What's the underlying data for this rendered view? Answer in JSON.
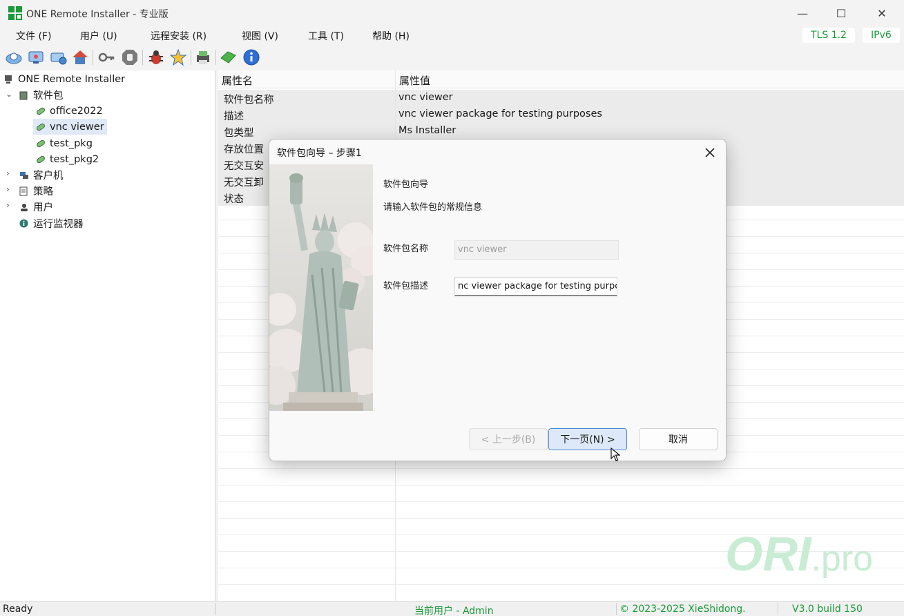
{
  "window": {
    "title": "ONE Remote Installer - 专业版",
    "minimize_glyph": "—",
    "maximize_glyph": "☐",
    "close_glyph": "✕"
  },
  "menu": {
    "items": [
      "文件 (F)",
      "用户 (U)",
      "远程安装 (R)",
      "视图 (V)",
      "工具 (T)",
      "帮助 (H)"
    ],
    "badges": [
      "TLS 1.2",
      "IPv6"
    ]
  },
  "toolbar": {
    "icons": [
      "connect-icon",
      "monitor-icon",
      "network-icon",
      "house-icon",
      "key-icon",
      "stop-hand-icon",
      "bug-icon",
      "star-icon",
      "printer-icon",
      "gem-icon",
      "info-icon"
    ]
  },
  "tree": {
    "root": "ONE Remote Installer",
    "packages": "软件包",
    "package_items": [
      "office2022",
      "vnc viewer",
      "test_pkg",
      "test_pkg2"
    ],
    "clients": "客户机",
    "policies": "策略",
    "users": "用户",
    "monitor": "运行监视器"
  },
  "properties": {
    "col_name": "属性名",
    "col_value": "属性值",
    "rows": [
      {
        "k": "软件包名称",
        "v": "vnc viewer"
      },
      {
        "k": "描述",
        "v": "vnc viewer package for testing purposes"
      },
      {
        "k": "包类型",
        "v": "Ms Installer"
      },
      {
        "k": "存放位置",
        "v": ""
      },
      {
        "k": "无交互安",
        "v": ""
      },
      {
        "k": "无交互卸",
        "v": ""
      },
      {
        "k": "状态",
        "v": ""
      }
    ]
  },
  "status": {
    "ready": "Ready",
    "user": "当前用户 - Admin",
    "copyright": "© 2023-2025 XieShidong.",
    "version": "V3.0 build 150"
  },
  "watermark": {
    "brand": "ORI",
    "suffix": ".pro"
  },
  "dialog": {
    "title": "软件包向导 – 步骤1",
    "heading": "软件包向导",
    "subheading": "请输入软件包的常规信息",
    "name_label": "软件包名称",
    "name_value": "vnc viewer",
    "desc_label": "软件包描述",
    "desc_value": "nc viewer package for testing purposes",
    "back_button": "< 上一步(B)",
    "next_button": "下一页(N) >",
    "cancel_button": "取消"
  },
  "colors": {
    "accent_green": "#1a9a3a",
    "selection": "#dfe9f7",
    "primary_button": "#dde9f8",
    "watermark": "#c9ecd4"
  }
}
